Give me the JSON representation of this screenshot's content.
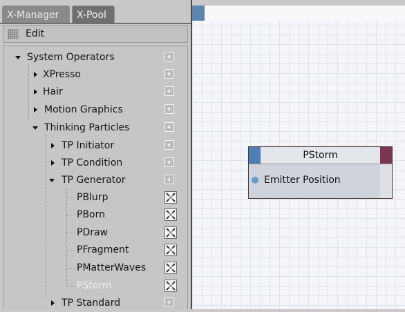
{
  "tabs": [
    {
      "label": "X-Manager",
      "active": false
    },
    {
      "label": "X-Pool",
      "active": true
    }
  ],
  "toolbar": {
    "menu_icon": "grid-handle-icon",
    "edit_label": "Edit"
  },
  "tree": {
    "system_operators": "System Operators",
    "xpresso": "XPresso",
    "hair": "Hair",
    "motion_graphics": "Motion Graphics",
    "thinking_particles": "Thinking Particles",
    "tp_initiator": "TP Initiator",
    "tp_condition": "TP Condition",
    "tp_generator": "TP Generator",
    "pblurp": "PBlurp",
    "pborn": "PBorn",
    "pdraw": "PDraw",
    "pfragment": "PFragment",
    "pmatterwaves": "PMatterWaves",
    "pstorm": "PStorm",
    "tp_standard": "TP Standard"
  },
  "node": {
    "title": "PStorm",
    "input_port": "Emitter Position",
    "colors": {
      "input_header": "#4f7eb3",
      "output_header": "#7c3550",
      "port_dot": "#6a9ccb"
    }
  },
  "colors": {
    "panel_bg": "#c8c8c8",
    "canvas_bg": "#f3f5f8",
    "accent_blue": "#5c84ad"
  }
}
